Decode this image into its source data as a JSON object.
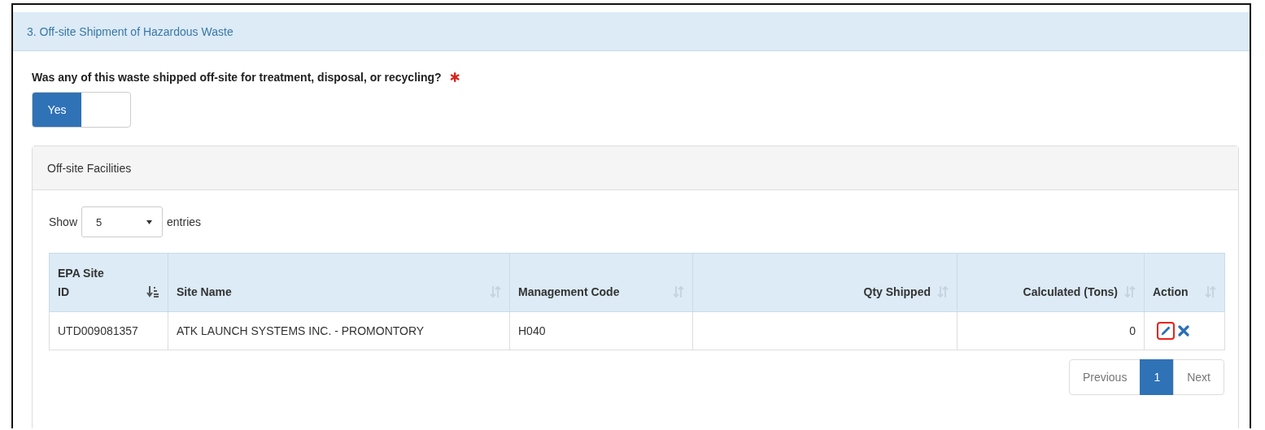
{
  "section": {
    "title": "3. Off-site Shipment of Hazardous Waste"
  },
  "question": {
    "label": "Was any of this waste shipped off-site for treatment, disposal, or recycling?",
    "required": true
  },
  "toggle": {
    "label": "Yes",
    "on": true
  },
  "panel": {
    "title": "Off-site Facilities",
    "length_menu": {
      "before": "Show",
      "value": "5",
      "after": "entries"
    },
    "table": {
      "columns": [
        {
          "label": "EPA Site ID",
          "kind": "text",
          "sorted": true
        },
        {
          "label": "Site Name",
          "kind": "text",
          "sorted": false
        },
        {
          "label": "Management Code",
          "kind": "text",
          "sorted": false
        },
        {
          "label": "Qty Shipped",
          "kind": "number",
          "sorted": false
        },
        {
          "label": "Calculated (Tons)",
          "kind": "number",
          "sorted": false
        },
        {
          "label": "Action",
          "kind": "text",
          "sorted": false
        }
      ],
      "rows": [
        {
          "cells": [
            "UTD009081357",
            "ATK LAUNCH SYSTEMS INC. - PROMONTORY",
            "H040",
            "",
            "0"
          ],
          "edit_highlighted": true
        }
      ]
    },
    "pagination": [
      {
        "label": "Previous",
        "selected": false
      },
      {
        "label": "1",
        "selected": true
      },
      {
        "label": "Next",
        "selected": false
      }
    ]
  }
}
